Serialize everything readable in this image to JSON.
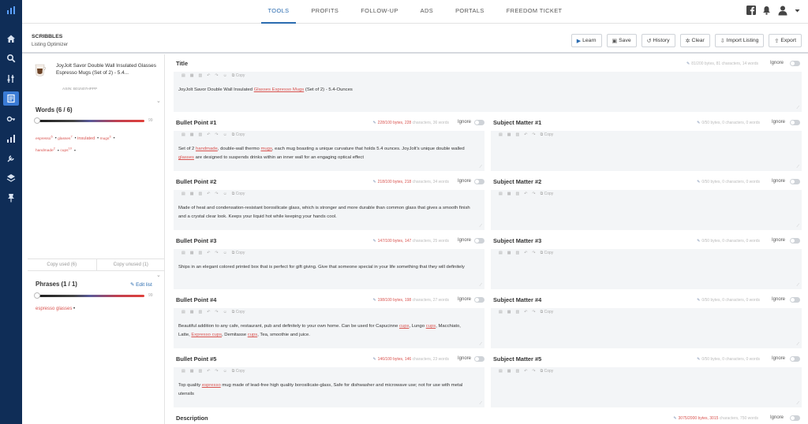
{
  "nav": {
    "tabs": [
      {
        "label": "TOOLS",
        "active": true
      },
      {
        "label": "PROFITS",
        "active": false
      },
      {
        "label": "FOLLOW-UP",
        "active": false
      },
      {
        "label": "ADS",
        "active": false
      },
      {
        "label": "PORTALS",
        "active": false
      },
      {
        "label": "FREEDOM TICKET",
        "active": false
      }
    ],
    "icons": [
      "facebook-icon",
      "bell-icon",
      "user-icon",
      "chevron-down-icon"
    ]
  },
  "sidebar": {
    "icons": [
      "logo-icon",
      "home-icon",
      "search-icon",
      "sliders-icon",
      "scribbles-icon",
      "key-icon",
      "chart-icon",
      "tools-icon",
      "layers-icon",
      "pin-icon"
    ],
    "active_index": 4
  },
  "header": {
    "brand": "SCRIBBLES",
    "subtitle": "Listing Optimizer",
    "actions": [
      {
        "label": "Learn",
        "icon": "video-icon"
      },
      {
        "label": "Save",
        "icon": "save-icon"
      },
      {
        "label": "History",
        "icon": "history-icon"
      },
      {
        "label": "Clear",
        "icon": "gear-icon"
      },
      {
        "label": "Import Listing",
        "icon": "import-icon"
      },
      {
        "label": "Export",
        "icon": "export-icon"
      }
    ]
  },
  "product": {
    "title": "JoyJolt Savor Double Wall Insulated Glasses Espresso Mugs (Set of 2) - 5.4...",
    "asin": "ASIN: B01N07HPPP"
  },
  "words": {
    "heading": "Words (6 / 6)",
    "slider_max": "99",
    "items": [
      {
        "text": "espresso",
        "count": "6",
        "small": true
      },
      {
        "text": "glasses",
        "count": "7",
        "small": true
      },
      {
        "text": "insulated",
        "count": "",
        "small": false
      },
      {
        "text": "mugs",
        "count": "3",
        "small": true
      },
      {
        "text": "handmade",
        "count": "2",
        "small": true
      },
      {
        "text": "cups",
        "count": "10",
        "small": true
      }
    ],
    "copy_used": "Copy used (6)",
    "copy_unused": "Copy unused (1)"
  },
  "phrases": {
    "heading": "Phrases (1 / 1)",
    "edit_list": "Edit list",
    "slider_max": "99",
    "items": [
      "espresso glasses"
    ]
  },
  "editor": {
    "ignore_label": "Ignore",
    "copy_label": "Copy",
    "title": {
      "heading": "Title",
      "meta_bytes": "",
      "meta_rest": "81/200 bytes, 81 characters, 14 words",
      "text": "JoyJolt Savor Double Wall Insulated Glasses Espresso Mugs (Set of 2) - 5.4-Ounces",
      "highlight": "Glasses Espresso Mugs"
    },
    "bullets": [
      {
        "heading": "Bullet Point #1",
        "meta_bytes": "228/100 bytes, 228",
        "meta_rest": "characters, 36 words",
        "text": "Set of 2 handmade, double-wall thermo mugs, each mug boasting a unique curvature that holds 5.4 ounces. JoyJolt's unique double walled glasses are designed to suspends drinks within an inner wall for an engaging optical effect"
      },
      {
        "heading": "Bullet Point #2",
        "meta_bytes": "218/100 bytes, 218",
        "meta_rest": "characters, 34 words",
        "text": "Made of heat and condensation-resistant borosilicate glass, which is stronger and more durable than common glass that gives a smooth finish and a crystal clear look. Keeps your liquid hot while keeping your hands cool."
      },
      {
        "heading": "Bullet Point #3",
        "meta_bytes": "147/100 bytes, 147",
        "meta_rest": "characters, 25 words",
        "text": "Ships in an elegant colored printed box that is perfect for gift giving. Give that someone special in your life something that they will definitely"
      },
      {
        "heading": "Bullet Point #4",
        "meta_bytes": "198/100 bytes, 198",
        "meta_rest": "characters, 27 words",
        "text": "Beautiful addition to any cafe, restaurant, pub and definitely to your own home. Can be used for Capucinne cups, Lungo cups, Macchiato, Latte, Expresso cups, Demitasse cups, Tea, smoothie and juice."
      },
      {
        "heading": "Bullet Point #5",
        "meta_bytes": "146/100 bytes, 146",
        "meta_rest": "characters, 23 words",
        "text": "Top quality espresso mug made of lead-free high quality borosilicate-glass, Safe for dishwasher and microwave use; not for use with metal utensils"
      }
    ],
    "subjects": [
      {
        "heading": "Subject Matter #1",
        "meta_rest": "0/50 bytes, 0 characters, 0 words"
      },
      {
        "heading": "Subject Matter #2",
        "meta_rest": "0/50 bytes, 0 characters, 0 words"
      },
      {
        "heading": "Subject Matter #3",
        "meta_rest": "0/50 bytes, 0 characters, 0 words"
      },
      {
        "heading": "Subject Matter #4",
        "meta_rest": "0/50 bytes, 0 characters, 0 words"
      },
      {
        "heading": "Subject Matter #5",
        "meta_rest": "0/50 bytes, 0 characters, 0 words"
      }
    ],
    "description": {
      "heading": "Description",
      "meta_bytes": "3075/2000 bytes, 3015",
      "meta_rest": "characters, 750 words"
    }
  },
  "colors": {
    "sidebar_bg": "#0f2d57",
    "accent": "#2b6cb0",
    "error": "#d9534f"
  }
}
